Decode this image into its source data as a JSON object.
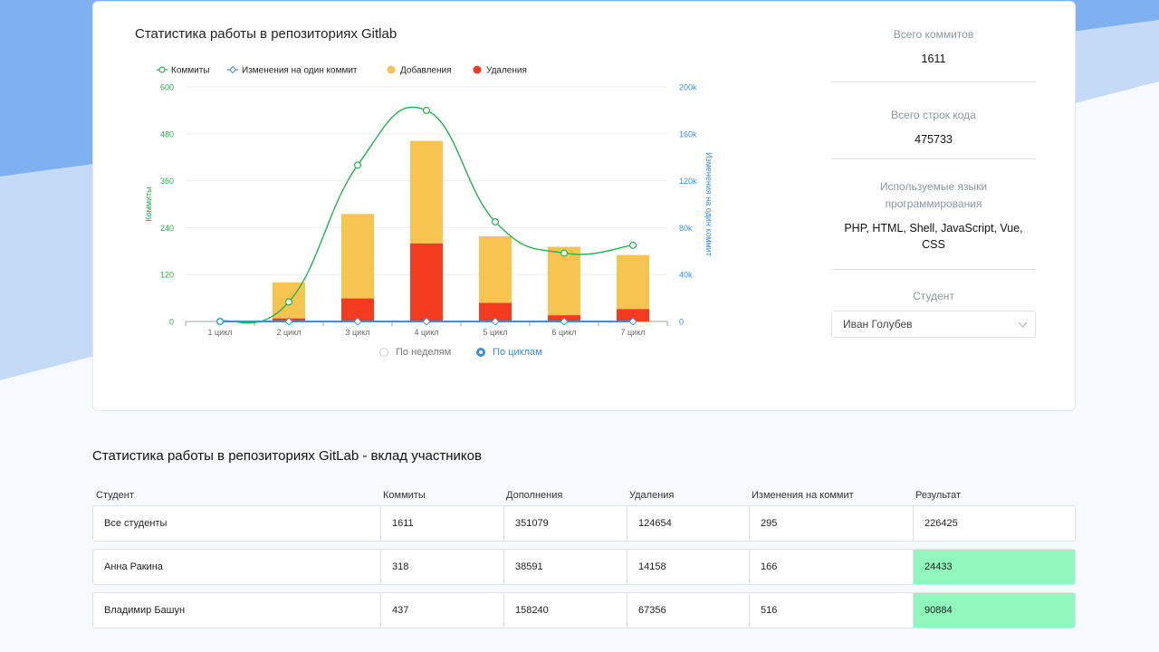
{
  "chart_section": {
    "title": "Статистика работы в репозиториях Gitlab",
    "view_options": [
      {
        "label": "По неделям",
        "selected": false
      },
      {
        "label": "По циклам",
        "selected": true
      }
    ]
  },
  "chart_data": {
    "type": "bar",
    "categories": [
      "1 цикл",
      "2 цикл",
      "3 цикл",
      "4 цикл",
      "5 цикл",
      "6 цикл",
      "7 цикл"
    ],
    "series": [
      {
        "name": "Коммиты",
        "kind": "line",
        "axis": "left",
        "color": "#22b24c",
        "values": [
          0,
          50,
          400,
          540,
          255,
          175,
          195
        ]
      },
      {
        "name": "Изменения на один коммит",
        "kind": "line",
        "axis": "right",
        "color": "#3a8ee6",
        "values": [
          0,
          0,
          0,
          0,
          0,
          0,
          0
        ]
      },
      {
        "name": "Добавления",
        "kind": "bar",
        "axis": "left",
        "stack": "changes",
        "color": "#f7c450",
        "values": [
          0,
          92,
          216,
          262,
          170,
          175,
          138
        ]
      },
      {
        "name": "Удаления",
        "kind": "bar",
        "axis": "left",
        "stack": "changes",
        "color": "#f53b1f",
        "values": [
          0,
          8,
          59,
          200,
          48,
          16,
          32
        ]
      }
    ],
    "left_axis": {
      "label": "Коммиты",
      "ticks": [
        "0",
        "120",
        "240",
        "360",
        "480",
        "600"
      ],
      "range": [
        0,
        600
      ],
      "color": "#22b24c"
    },
    "right_axis": {
      "label": "Изменения на один коммит",
      "ticks": [
        "0",
        "40k",
        "80k",
        "120k",
        "160k",
        "200k"
      ],
      "range": [
        0,
        200000
      ],
      "color": "#3a8ee6"
    },
    "legend_position": "top-left",
    "grid": true
  },
  "stats": {
    "commits": {
      "label": "Всего коммитов",
      "value": "1611"
    },
    "lines": {
      "label": "Всего строк кода",
      "value": "475733"
    },
    "languages": {
      "label": "Используемые языки программирования",
      "value": "PHP, HTML, Shell, JavaScript, Vue, CSS"
    },
    "student": {
      "label": "Студент",
      "selected": "Иван Голубев"
    }
  },
  "contrib_section": {
    "title": "Статистика работы в репозиториях GitLab - вклад участников",
    "columns": [
      "Студент",
      "Коммиты",
      "Дополнения",
      "Удаления",
      "Изменения на коммит",
      "Результат"
    ],
    "rows": [
      {
        "cells": [
          "Все студенты",
          "1611",
          "351079",
          "124654",
          "295",
          "226425"
        ],
        "highlight": ""
      },
      {
        "cells": [
          "Анна Ракина",
          "318",
          "38591",
          "14158",
          "166",
          "24433"
        ],
        "highlight": "#92f7bd"
      },
      {
        "cells": [
          "Владимир Башун",
          "437",
          "158240",
          "67356",
          "516",
          "90884"
        ],
        "highlight": "#92f7bd"
      }
    ]
  }
}
